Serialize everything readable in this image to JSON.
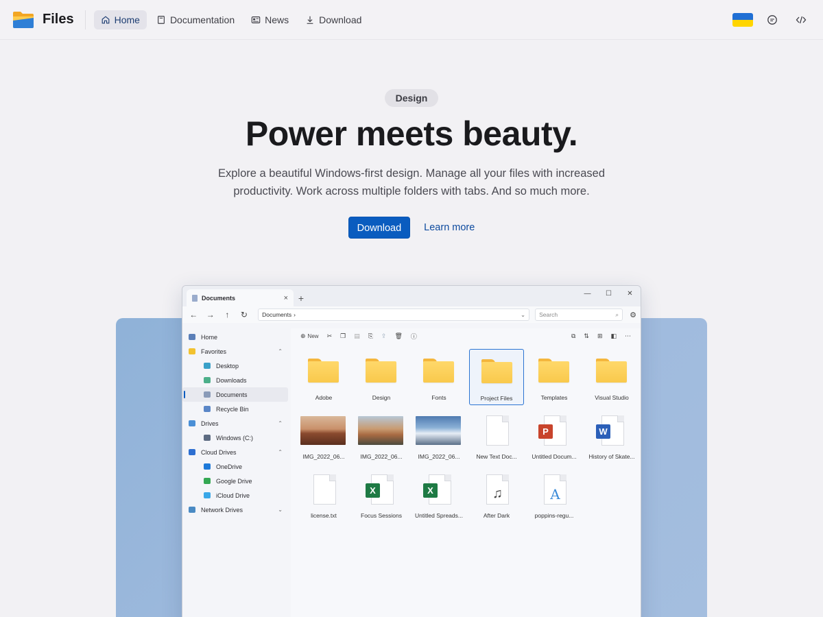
{
  "nav": {
    "brand": "Files",
    "links": [
      {
        "label": "Home",
        "icon": "home-icon",
        "active": true
      },
      {
        "label": "Documentation",
        "icon": "book-icon",
        "active": false
      },
      {
        "label": "News",
        "icon": "newspaper-icon",
        "active": false
      },
      {
        "label": "Download",
        "icon": "download-icon",
        "active": false
      }
    ]
  },
  "hero": {
    "badge": "Design",
    "headline": "Power meets beauty.",
    "subtext": "Explore a beautiful Windows-first design. Manage all your files with increased productivity. Work across multiple folders with tabs. And so much more.",
    "primary_button": "Download",
    "secondary_link": "Learn more"
  },
  "window": {
    "tab_title": "Documents",
    "path": "Documents",
    "search_placeholder": "Search",
    "toolbar_new": "New",
    "sidebar": [
      {
        "label": "Home",
        "indent": false,
        "color": "#5b7fb8"
      },
      {
        "label": "Favorites",
        "indent": false,
        "color": "#f2c230",
        "chevron": "up"
      },
      {
        "label": "Desktop",
        "indent": true,
        "color": "#3aa0c8"
      },
      {
        "label": "Downloads",
        "indent": true,
        "color": "#4caf8a"
      },
      {
        "label": "Documents",
        "indent": true,
        "color": "#8a9bb8",
        "selected": true
      },
      {
        "label": "Recycle Bin",
        "indent": true,
        "color": "#5a86c7"
      },
      {
        "label": "Drives",
        "indent": false,
        "color": "#4a8fd6",
        "chevron": "up"
      },
      {
        "label": "Windows (C:)",
        "indent": true,
        "color": "#5d6b82"
      },
      {
        "label": "Cloud Drives",
        "indent": false,
        "color": "#2d6fd1",
        "chevron": "up"
      },
      {
        "label": "OneDrive",
        "indent": true,
        "color": "#1e79d9"
      },
      {
        "label": "Google Drive",
        "indent": true,
        "color": "#34a853"
      },
      {
        "label": "iCloud Drive",
        "indent": true,
        "color": "#3aa7e8"
      },
      {
        "label": "Network Drives",
        "indent": false,
        "color": "#4a8ac4",
        "chevron": "down"
      }
    ],
    "files": [
      {
        "name": "Adobe",
        "kind": "folder"
      },
      {
        "name": "Design",
        "kind": "folder"
      },
      {
        "name": "Fonts",
        "kind": "folder"
      },
      {
        "name": "Project Files",
        "kind": "folder",
        "selected": true
      },
      {
        "name": "Templates",
        "kind": "folder"
      },
      {
        "name": "Visual Studio",
        "kind": "folder"
      },
      {
        "name": "IMG_2022_06...",
        "kind": "photo",
        "tone": "desert"
      },
      {
        "name": "IMG_2022_06...",
        "kind": "photo",
        "tone": "mountain"
      },
      {
        "name": "IMG_2022_06...",
        "kind": "photo",
        "tone": "snow"
      },
      {
        "name": "New Text Doc...",
        "kind": "doc"
      },
      {
        "name": "Untitled Docum...",
        "kind": "ppt",
        "badge": "P"
      },
      {
        "name": "History of Skate...",
        "kind": "word",
        "badge": "W"
      },
      {
        "name": "license.txt",
        "kind": "doc"
      },
      {
        "name": "Focus Sessions",
        "kind": "excel",
        "badge": "X"
      },
      {
        "name": "Untitled Spreads...",
        "kind": "excel",
        "badge": "X"
      },
      {
        "name": "After Dark",
        "kind": "audio",
        "glyph": "♫"
      },
      {
        "name": "poppins-regu...",
        "kind": "font",
        "glyph": "A"
      }
    ]
  },
  "colors": {
    "accent": "#0a5cbf",
    "folder": "#f9c94c",
    "panel": "#9fbadd"
  }
}
